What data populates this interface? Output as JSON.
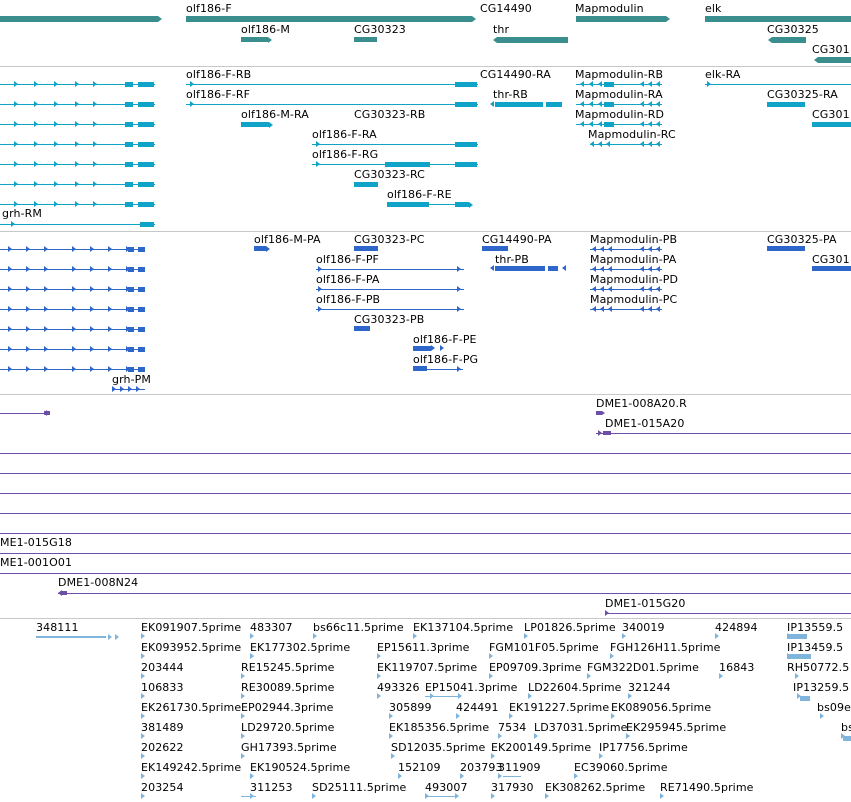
{
  "colors": {
    "genes": "#3a8e8e",
    "transcripts": "#0fa3c7",
    "proteins": "#2e67c9",
    "clones": "#6e4fa8",
    "ests": "#7fb5dc",
    "separator": "#c8c8c8"
  },
  "tracks": {
    "genes": {
      "labels": [
        "olf186-F",
        "CG14490",
        "Mapmodulin",
        "elk",
        "olf186-M",
        "CG30323",
        "thr",
        "CG30325",
        "CG301"
      ]
    },
    "transcripts": {
      "labels": [
        "olf186-F-RB",
        "CG14490-RA",
        "Mapmodulin-RB",
        "elk-RA",
        "olf186-F-RF",
        "thr-RB",
        "Mapmodulin-RA",
        "CG30325-RA",
        "olf186-M-RA",
        "CG30323-RB",
        "Mapmodulin-RD",
        "CG301",
        "Mapmodulin-RC",
        "olf186-F-RA",
        "olf186-F-RG",
        "CG30323-RC",
        "olf186-F-RE",
        "grh-RM"
      ]
    },
    "proteins": {
      "labels": [
        "olf186-M-PA",
        "CG30323-PC",
        "CG14490-PA",
        "Mapmodulin-PB",
        "CG30325-PA",
        "olf186-F-PF",
        "thr-PB",
        "Mapmodulin-PA",
        "CG301",
        "olf186-F-PA",
        "Mapmodulin-PD",
        "olf186-F-PB",
        "Mapmodulin-PC",
        "CG30323-PB",
        "olf186-F-PE",
        "olf186-F-PG",
        "grh-PM"
      ]
    },
    "clones": {
      "labels": [
        "DME1-008A20.R",
        "DME1-015A20",
        "ME1-015G18",
        "ME1-001O01",
        "DME1-008N24",
        "DME1-015G20"
      ]
    },
    "ests": {
      "labels": [
        "348111",
        "EK091907.5prime",
        "483307",
        "bs66c11.5prime",
        "EK137104.5prime",
        "LP01826.5prime",
        "340019",
        "424894",
        "IP13559.5",
        "EK093952.5prime",
        "EK177302.5prime",
        "EP15611.3prime",
        "FGM101F05.5prime",
        "FGH126H11.5prime",
        "IP13459.5",
        "203444",
        "RE15245.5prime",
        "EK119707.5prime",
        "EP09709.3prime",
        "FGM322D01.5prime",
        "16843",
        "RH50772.5",
        "106833",
        "RE30089.5prime",
        "493326",
        "EP15041.3prime",
        "LD22604.5prime",
        "321244",
        "IP13259.5",
        "EK261730.5prime",
        "EP02944.3prime",
        "305899",
        "424491",
        "EK191227.5prime",
        "EK089056.5prime",
        "bs09e",
        "381489",
        "LD29720.5prime",
        "EK185356.5prime",
        "7534",
        "LD37031.5prime",
        "EK295945.5prime",
        "bs",
        "202622",
        "GH17393.5prime",
        "SD12035.5prime",
        "EK200149.5prime",
        "IP17756.5prime",
        "EK149242.5prime",
        "EK190524.5prime",
        "152109",
        "203793",
        "311909",
        "EC39060.5prime",
        "203254",
        "311253",
        "SD25111.5prime",
        "493007",
        "317930",
        "EK308262.5prime",
        "RE71490.5prime"
      ]
    }
  }
}
